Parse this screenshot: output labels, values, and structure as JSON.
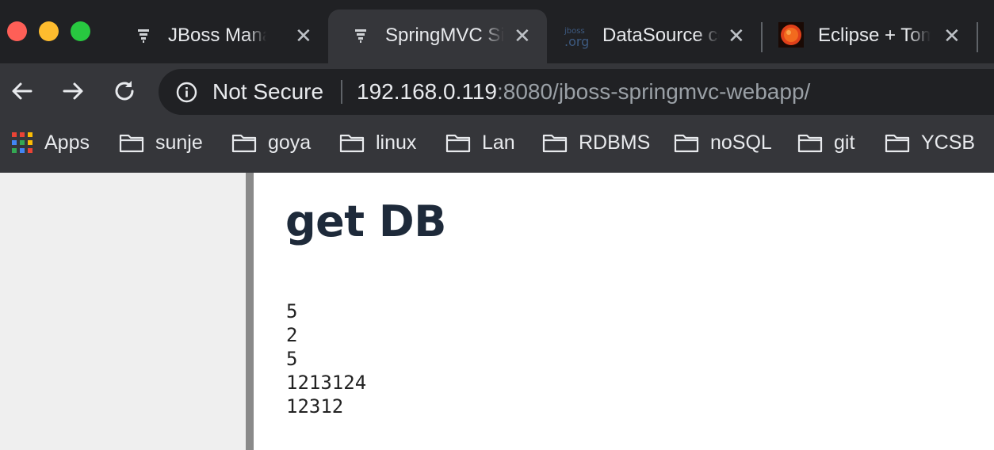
{
  "tabs": [
    {
      "title": "JBoss Management",
      "icon": "jboss-favicon",
      "active": false
    },
    {
      "title": "SpringMVC Simple",
      "icon": "jboss-favicon",
      "active": true
    },
    {
      "title": "DataSource configuration",
      "icon": "jboss-org-favicon",
      "active": false
    },
    {
      "title": "Eclipse + Tomcat",
      "icon": "sun-favicon",
      "active": false
    }
  ],
  "toolbar": {
    "security_label": "Not Secure",
    "url_host": "192.168.0.119",
    "url_rest": ":8080/jboss-springmvc-webapp/"
  },
  "bookmarks": {
    "apps_label": "Apps",
    "folders": [
      "sunje",
      "goya",
      "linux",
      "Lan",
      "RDBMS",
      "noSQL",
      "git",
      "YCSB"
    ]
  },
  "page": {
    "title": "get DB",
    "values": [
      "5",
      "2",
      "5",
      "1213124",
      "12312"
    ]
  },
  "colors": {
    "chrome_dark": "#202124",
    "chrome_toolbar": "#35363a",
    "traffic_close": "#fe5f57",
    "traffic_min": "#febc2e",
    "traffic_max": "#28c840",
    "title_color": "#1e2a3a"
  }
}
